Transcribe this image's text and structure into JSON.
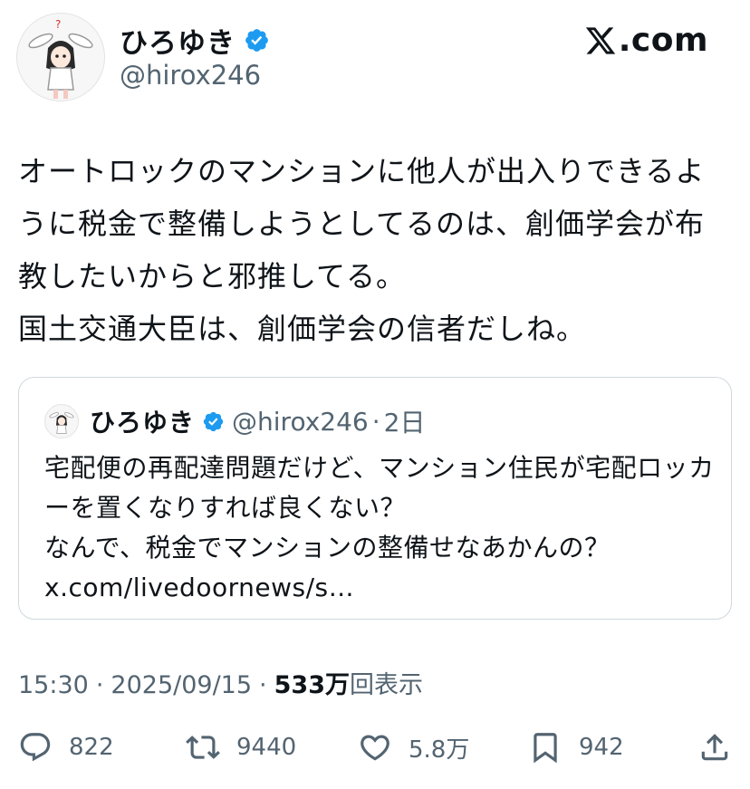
{
  "header": {
    "display_name": "ひろゆき",
    "handle": "@hirox246",
    "site_logo_text": ".com",
    "site_logo_icon": "x-logo-icon",
    "verified_color": "#1d9bf0"
  },
  "tweet": {
    "text": "オートロックのマンションに他人が出入りできるように税金で整備しようとしてるのは、創価学会が布教したいからと邪推してる。\n国土交通大臣は、創価学会の信者だしね。"
  },
  "quote": {
    "display_name": "ひろゆき",
    "handle": "@hirox246",
    "dot": "·",
    "time": "2日",
    "text": "宅配便の再配達問題だけど、マンション住民が宅配ロッカーを置くなりすれば良くない？\nなんで、税金でマンションの整備せなあかんの？\nx.com/livedoornews/s…"
  },
  "meta": {
    "time": "15:30",
    "sep1": "·",
    "date": "2025/09/15",
    "sep2": "·",
    "views": "533万",
    "views_suffix": "回表示"
  },
  "actions": {
    "replies": "822",
    "retweets": "9440",
    "likes": "5.8万",
    "bookmarks": "942"
  }
}
